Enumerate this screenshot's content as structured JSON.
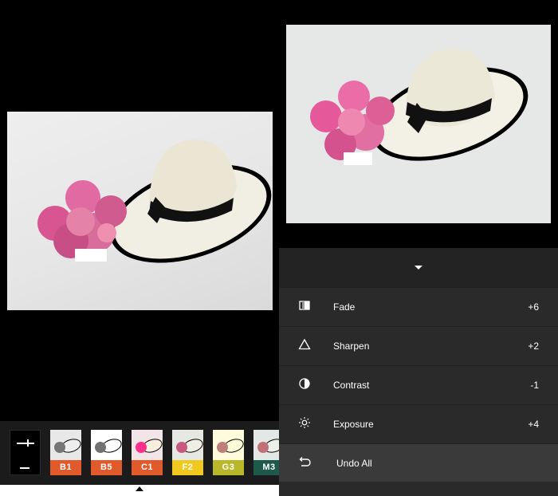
{
  "filters": [
    {
      "label": "B1",
      "color": "#e05a2b"
    },
    {
      "label": "B5",
      "color": "#e05a2b"
    },
    {
      "label": "C1",
      "color": "#e05a2b"
    },
    {
      "label": "F2",
      "color": "#f0c81e"
    },
    {
      "label": "G3",
      "color": "#b8b82a"
    },
    {
      "label": "M3",
      "color": "#1e5a4a"
    }
  ],
  "adjustments": [
    {
      "label": "Fade",
      "value": "+6",
      "icon": "fade-icon"
    },
    {
      "label": "Sharpen",
      "value": "+2",
      "icon": "sharpen-triangle-icon"
    },
    {
      "label": "Contrast",
      "value": "-1",
      "icon": "contrast-circle-icon"
    },
    {
      "label": "Exposure",
      "value": "+4",
      "icon": "exposure-sun-icon"
    }
  ],
  "undo": {
    "label": "Undo All",
    "icon": "undo-icon"
  }
}
